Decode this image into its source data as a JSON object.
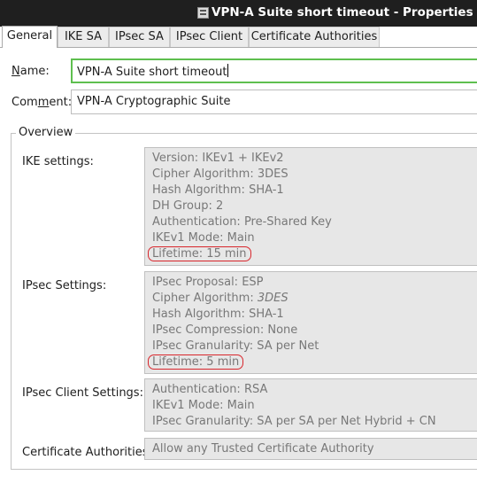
{
  "window": {
    "title": "VPN-A Suite short timeout - Properties",
    "icon": "properties-window-icon"
  },
  "tabs": [
    {
      "label": "General",
      "active": true
    },
    {
      "label": "IKE SA",
      "active": false
    },
    {
      "label": "IPsec SA",
      "active": false
    },
    {
      "label": "IPsec Client",
      "active": false
    },
    {
      "label": "Certificate Authorities",
      "active": false
    }
  ],
  "form": {
    "name_label": "Name:",
    "name_value": "VPN-A Suite short timeout",
    "comment_label": "Comment:",
    "comment_value": "VPN-A Cryptographic Suite"
  },
  "overview": {
    "legend": "Overview",
    "ike": {
      "label": "IKE settings:",
      "lines": [
        "Version: IKEv1 + IKEv2",
        "Cipher Algorithm: 3DES",
        "Hash Algorithm: SHA-1",
        "DH Group: 2",
        "Authentication: Pre-Shared Key",
        "IKEv1 Mode: Main",
        "Lifetime: 15 min"
      ]
    },
    "ipsec": {
      "label": "IPsec Settings:",
      "lines": [
        "IPsec Proposal: ESP",
        "Cipher Algorithm: ",
        "Hash Algorithm: SHA-1",
        "IPsec Compression: None",
        "IPsec Granularity: SA per Net",
        "Lifetime: 5 min"
      ],
      "cipher_value_italic": "3DES"
    },
    "ipsec_client": {
      "label": "IPsec Client Settings:",
      "lines": [
        "Authentication: RSA",
        "IKEv1 Mode: Main",
        "IPsec Granularity: SA per SA per Net Hybrid + CN"
      ]
    },
    "cas": {
      "label": "Certificate Authorities:",
      "value": "Allow any Trusted Certificate Authority"
    }
  },
  "colors": {
    "highlight": "#d8262c",
    "focus_border": "#5ebf4f",
    "titlebar": "#1f1f1f"
  }
}
